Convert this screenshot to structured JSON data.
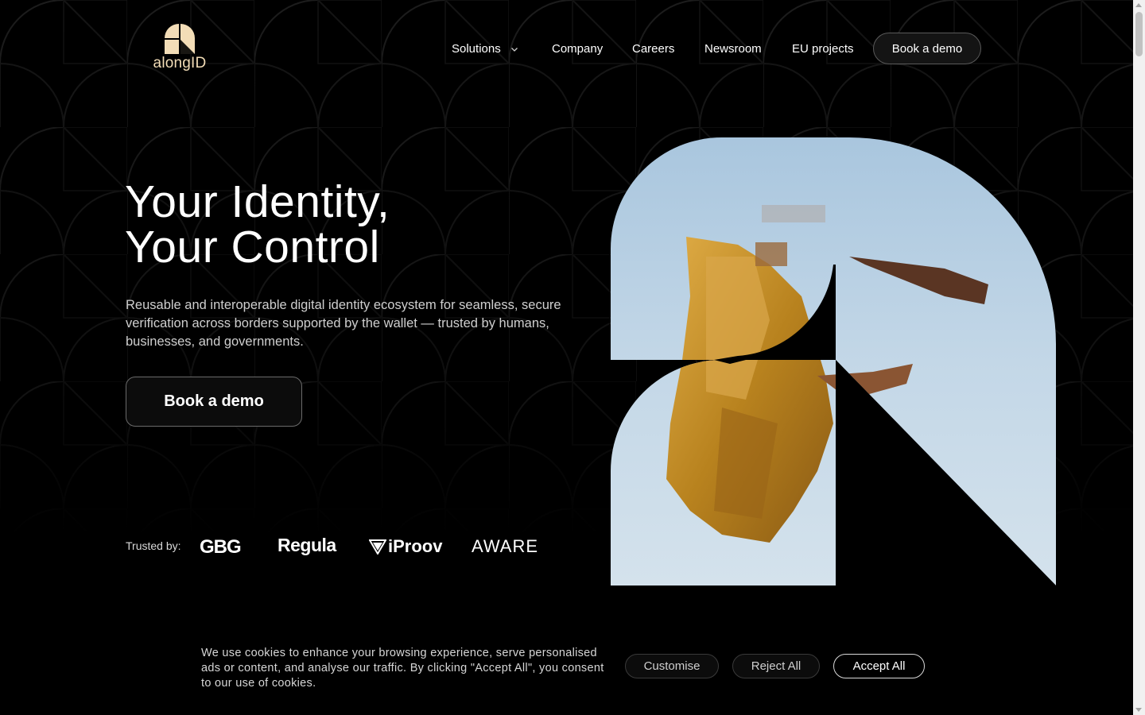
{
  "brand": {
    "name": "alongID",
    "accent_color": "#f3ddb7"
  },
  "nav": {
    "items": [
      {
        "label": "Solutions",
        "has_dropdown": true
      },
      {
        "label": "Company"
      },
      {
        "label": "Careers"
      },
      {
        "label": "Newsroom"
      },
      {
        "label": "EU projects"
      }
    ],
    "cta_label": "Book a demo"
  },
  "hero": {
    "title_line1": "Your Identity,",
    "title_line2": "Your Control",
    "subtitle": "Reusable and interoperable digital identity ecosystem for seamless, secure verification across borders supported by the wallet — trusted by humans, businesses, and governments.",
    "cta_label": "Book a demo"
  },
  "trusted": {
    "label": "Trusted by:",
    "partners": [
      "GBG",
      "Regula",
      "iProov",
      "AWARE"
    ]
  },
  "cookie": {
    "text": "We use cookies to enhance your browsing experience, serve personalised ads or content, and analyse our traffic. By clicking \"Accept All\", you consent to our use of cookies.",
    "customise_label": "Customise",
    "reject_label": "Reject All",
    "accept_label": "Accept All"
  },
  "icons": {
    "nav_dropdown": "chevron-down-icon",
    "logo": "alongid-logo-mark",
    "iproov": "iproov-triangle-icon"
  }
}
